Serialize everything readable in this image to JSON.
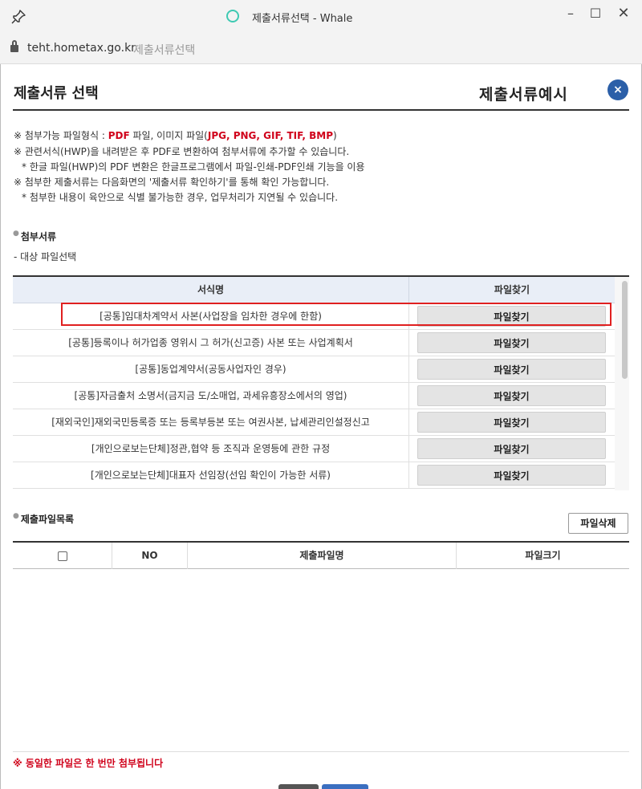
{
  "window": {
    "title": "제출서류선택 - Whale",
    "minimize": "–",
    "maximize": "☐",
    "close": "✕"
  },
  "address": {
    "domain": "teht.hometax.go.kr",
    "page_name": "제출서류선택"
  },
  "header": {
    "title": "제출서류 선택",
    "example_link": "제출서류예시",
    "close_symbol": "×"
  },
  "notes": {
    "line1_prefix": "※ 첨부가능 파일형식 : ",
    "line1_pdf": "PDF",
    "line1_mid": " 파일, 이미지 파일(",
    "line1_imgs": "JPG, PNG, GIF, TIF, BMP",
    "line1_suffix": ")",
    "line2": "※ 관련서식(HWP)을 내려받은 후 PDF로 변환하여 첨부서류에 추가할 수 있습니다.",
    "line3": "* 한글 파일(HWP)의 PDF 변환은 한글프로그램에서 파일-인쇄-PDF인쇄 기능을 이용",
    "line4": "※ 첨부한 제출서류는 다음화면의 '제출서류 확인하기'를 통해 확인 가능합니다.",
    "line5": "* 첨부한 내용이 육안으로 식별 불가능한 경우, 업무처리가 지연될 수 있습니다."
  },
  "attachments": {
    "section_title": "첨부서류",
    "sub_label": "- 대상 파일선택",
    "col_name": "서식명",
    "col_find": "파일찾기",
    "rows": [
      {
        "name": "[공통]임대차계약서 사본(사업장을 임차한 경우에 한함)",
        "button": "파일찾기"
      },
      {
        "name": "[공통]등록이나 허가업종 영위시 그 허가(신고증) 사본 또는 사업계획서",
        "button": "파일찾기"
      },
      {
        "name": "[공통]동업계약서(공동사업자인 경우)",
        "button": "파일찾기"
      },
      {
        "name": "[공통]자금출처 소명서(금지금 도/소매업, 과세유흥장소에서의 영업)",
        "button": "파일찾기"
      },
      {
        "name": "[재외국인]재외국민등록증 또는 등록부등본 또는 여권사본, 납세관리인설정신고",
        "button": "파일찾기"
      },
      {
        "name": "[개인으로보는단체]정관,협약 등 조직과 운영등에 관한 규정",
        "button": "파일찾기"
      },
      {
        "name": "[개인으로보는단체]대표자 선임장(선임 확인이 가능한 서류)",
        "button": "파일찾기"
      }
    ]
  },
  "submission": {
    "section_title": "제출파일목록",
    "delete_button": "파일삭제",
    "col_no": "NO",
    "col_filename": "제출파일명",
    "col_size": "파일크기"
  },
  "footer": {
    "warning": "※ 동일한 파일은 한 번만 첨부됩니다"
  },
  "colors": {
    "accent_blue": "#2b5fa8",
    "highlight_red": "#e02020",
    "warning_red": "#d0021b",
    "whale_green": "#3ec9b2"
  }
}
